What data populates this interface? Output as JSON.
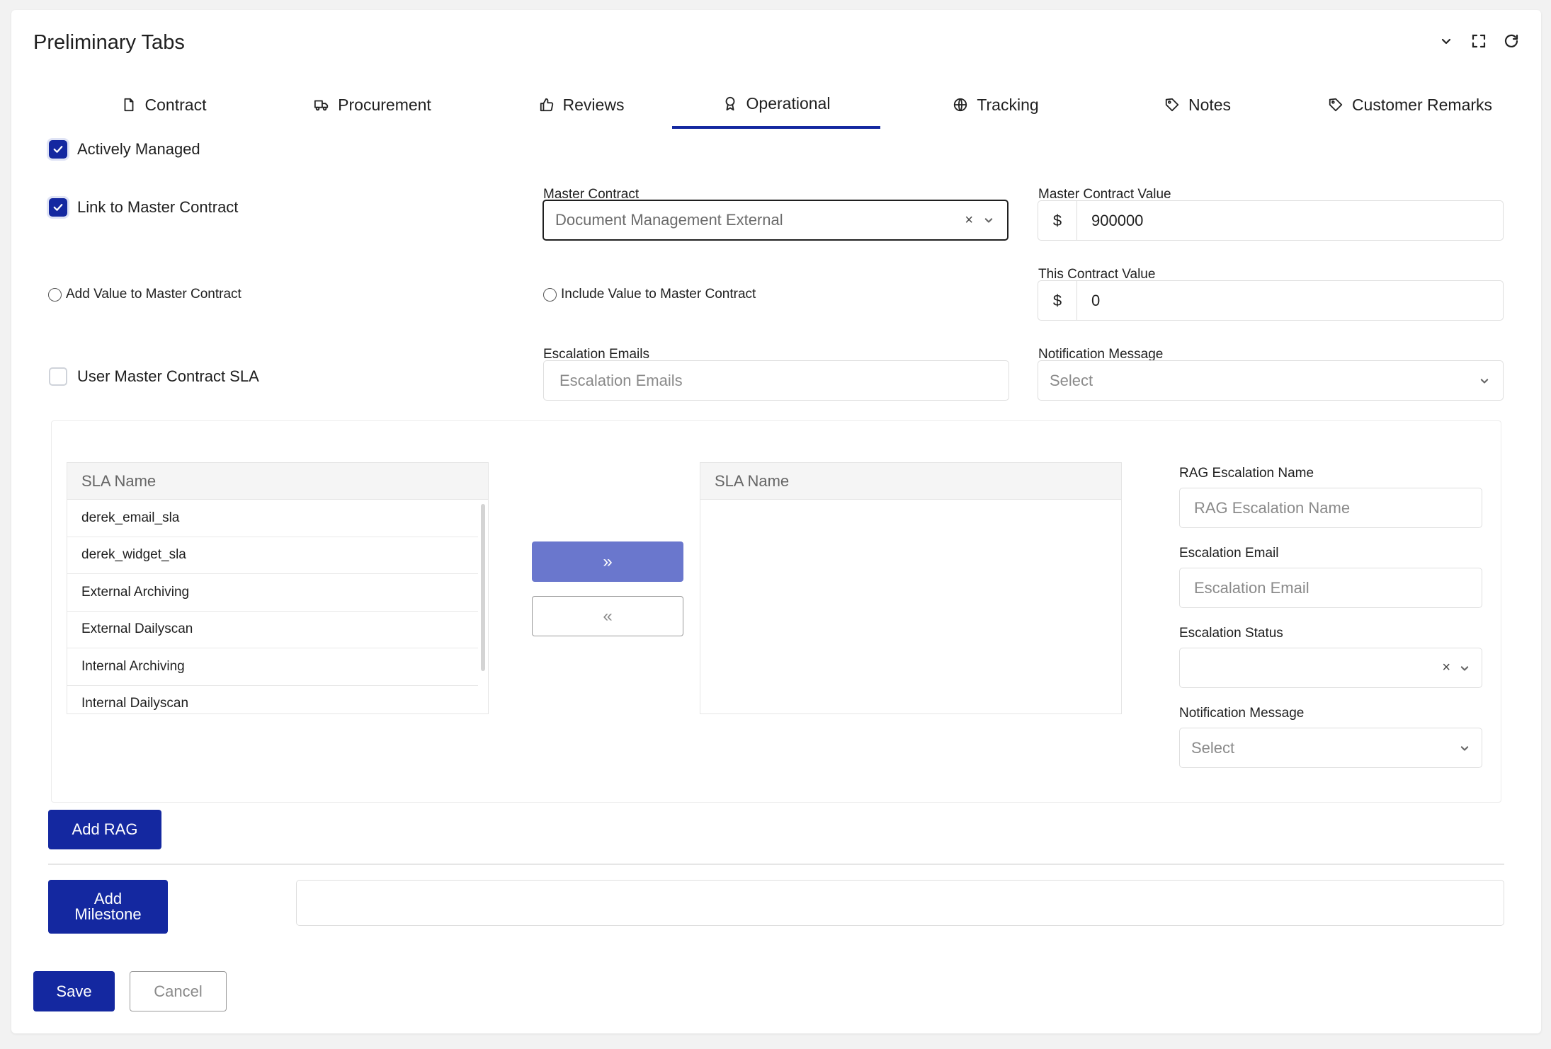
{
  "title": "Preliminary Tabs",
  "window_icons": [
    "chevron-down-icon",
    "fullscreen-icon",
    "refresh-icon"
  ],
  "tabs": [
    {
      "label": "Contract",
      "icon": "document-icon"
    },
    {
      "label": "Procurement",
      "icon": "truck-icon"
    },
    {
      "label": "Reviews",
      "icon": "thumbs-up-icon"
    },
    {
      "label": "Operational",
      "icon": "award-icon",
      "active": true
    },
    {
      "label": "Tracking",
      "icon": "globe-icon"
    },
    {
      "label": "Notes",
      "icon": "tag-icon"
    },
    {
      "label": "Customer Remarks",
      "icon": "tag-icon"
    }
  ],
  "form": {
    "actively_managed": {
      "label": "Actively Managed",
      "checked": true
    },
    "link_master": {
      "label": "Link to Master Contract",
      "checked": true
    },
    "add_value_master": "Add Value to Master Contract",
    "include_value_master": "Include Value to Master Contract",
    "user_master_sla": {
      "label": "User Master Contract SLA",
      "checked": false
    },
    "master_contract": {
      "label": "Master Contract",
      "value": "Document Management External"
    },
    "master_contract_value": {
      "label": "Master Contract Value",
      "currency": "$",
      "value": "900000"
    },
    "this_contract_value": {
      "label": "This Contract Value",
      "currency": "$",
      "value": "0"
    },
    "escalation_emails": {
      "label": "Escalation Emails",
      "placeholder": "Escalation Emails"
    },
    "notification_message": {
      "label": "Notification Message",
      "value": "Select"
    }
  },
  "sla": {
    "left_header": "SLA Name",
    "right_header": "SLA Name",
    "items": [
      "derek_email_sla",
      "derek_widget_sla",
      "External Archiving",
      "External Dailyscan",
      "Internal Archiving",
      "Internal Dailyscan"
    ],
    "move_right": "»",
    "move_left": "«",
    "rag_name": {
      "label": "RAG Escalation Name",
      "placeholder": "RAG Escalation Name"
    },
    "escalation_email": {
      "label": "Escalation Email",
      "placeholder": "Escalation Email"
    },
    "escalation_status": {
      "label": "Escalation Status",
      "value": ""
    },
    "notification_message": {
      "label": "Notification Message",
      "value": "Select"
    }
  },
  "buttons": {
    "add_rag": "Add RAG",
    "add_milestone_1": "Add",
    "add_milestone_2": "Milestone",
    "save": "Save",
    "cancel": "Cancel"
  },
  "colors": {
    "accent": "#1428a0",
    "accent_light": "#6a77cd"
  }
}
